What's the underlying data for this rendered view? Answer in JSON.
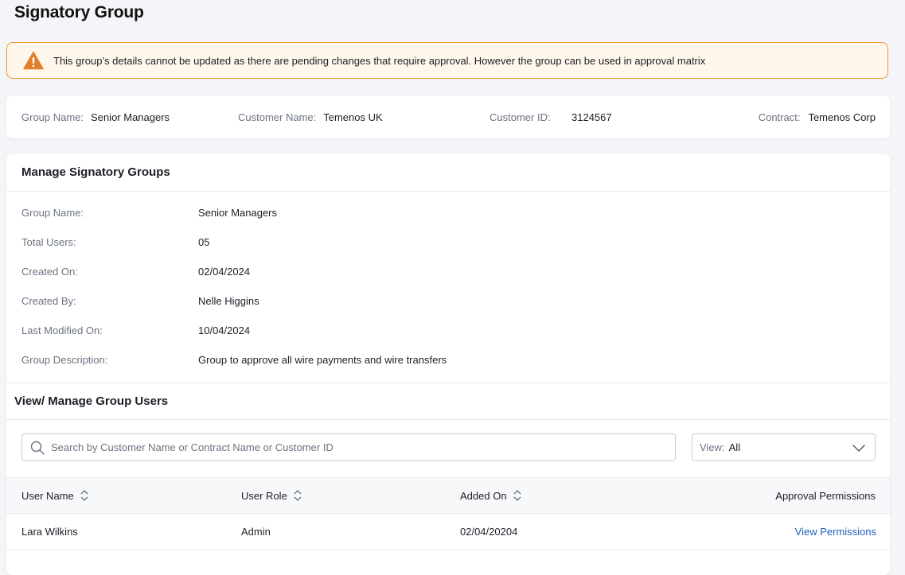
{
  "page": {
    "title": "Signatory Group"
  },
  "alert": {
    "message": "This group’s details cannot be updated as there are pending changes that require approval.  However the group can be used in approval matrix",
    "icon": "warning-icon",
    "color": "#e0802a"
  },
  "summary": {
    "group_name_label": "Group Name:",
    "group_name_value": "Senior Managers",
    "customer_name_label": "Customer Name:",
    "customer_name_value": "Temenos UK",
    "customer_id_label": "Customer ID:",
    "customer_id_value": "3124567",
    "contract_label": "Contract:",
    "contract_value": "Temenos Corp"
  },
  "manage": {
    "title": "Manage Signatory Groups",
    "details": [
      {
        "label": "Group Name:",
        "value": "Senior Managers"
      },
      {
        "label": "Total Users:",
        "value": "05"
      },
      {
        "label": "Created On:",
        "value": "02/04/2024"
      },
      {
        "label": "Created By:",
        "value": "Nelle Higgins"
      },
      {
        "label": "Last Modified On:",
        "value": "10/04/2024"
      },
      {
        "label": "Group Description:",
        "value": "Group to approve all wire payments and wire transfers"
      }
    ]
  },
  "users": {
    "title": "View/ Manage Group Users",
    "search_placeholder": "Search by Customer Name or Contract Name or Customer ID",
    "view_label": "View:",
    "view_value": "All",
    "columns": [
      "User Name",
      "User Role",
      "Added On",
      "Approval Permissions"
    ],
    "rows": [
      {
        "user_name": "Lara Wilkins",
        "user_role": "Admin",
        "added_on": "02/04/20204",
        "action": "View Permissions"
      }
    ]
  },
  "colors": {
    "link": "#1f5fb8",
    "alert_border": "#e89a2c",
    "background": "#f3f5f8"
  }
}
